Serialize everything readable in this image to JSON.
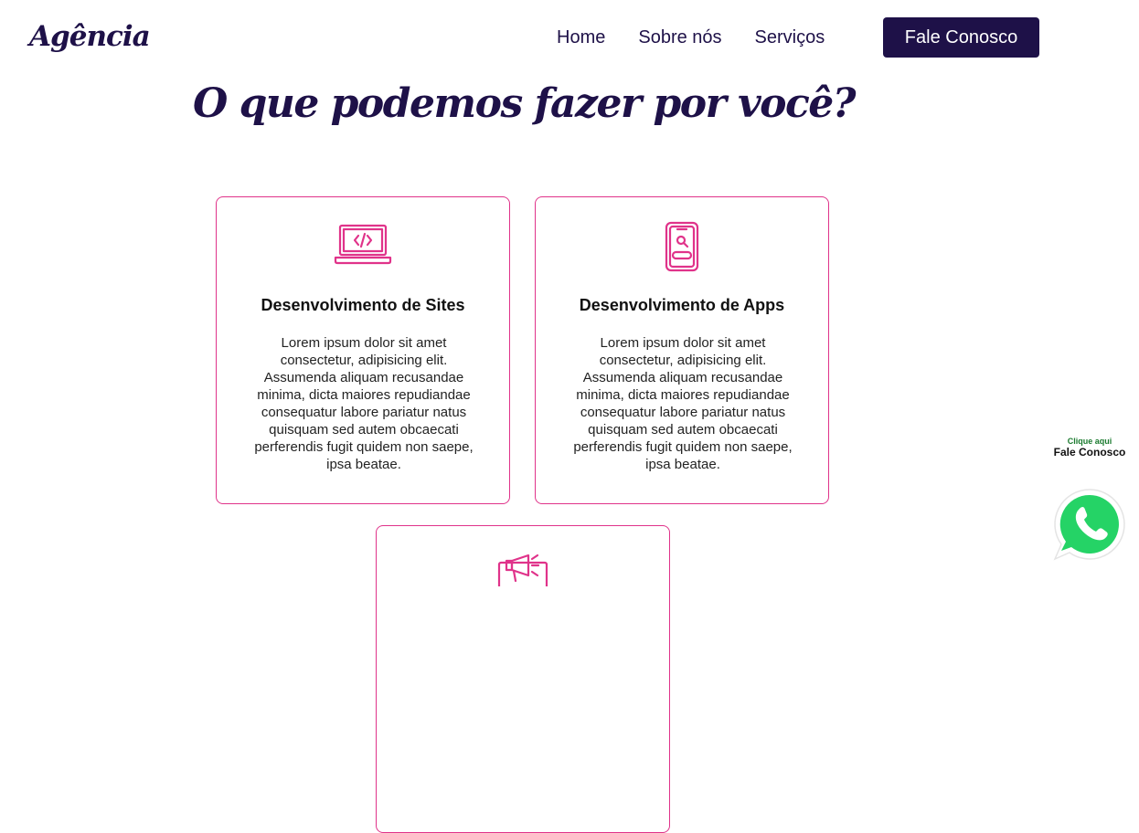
{
  "header": {
    "logo": "Agência",
    "nav": [
      "Home",
      "Sobre nós",
      "Serviços"
    ],
    "cta_label": "Fale Conosco"
  },
  "main": {
    "heading": "O que podemos fazer por você?",
    "cards": [
      {
        "icon": "laptop-code-icon",
        "title": "Desenvolvimento de Sites",
        "text": "Lorem ipsum dolor sit amet consectetur, adipisicing elit. Assumenda aliquam recusandae minima, dicta maiores repudiandae consequatur labore pariatur natus quisquam sed autem obcaecati perferendis fugit quidem non saepe, ipsa beatae."
      },
      {
        "icon": "mobile-search-icon",
        "title": "Desenvolvimento de Apps",
        "text": "Lorem ipsum dolor sit amet consectetur, adipisicing elit. Assumenda aliquam recusandae minima, dicta maiores repudiandae consequatur labore pariatur natus quisquam sed autem obcaecati perferendis fugit quidem non saepe, ipsa beatae."
      },
      {
        "icon": "megaphone-icon"
      }
    ]
  },
  "whatsapp": {
    "small_text": "Clique aqui",
    "big_text": "Fale Conosco",
    "icon": "whatsapp-icon"
  },
  "colors": {
    "brand": "#1e1148",
    "accent": "#e0338a",
    "whatsapp": "#25d366"
  }
}
